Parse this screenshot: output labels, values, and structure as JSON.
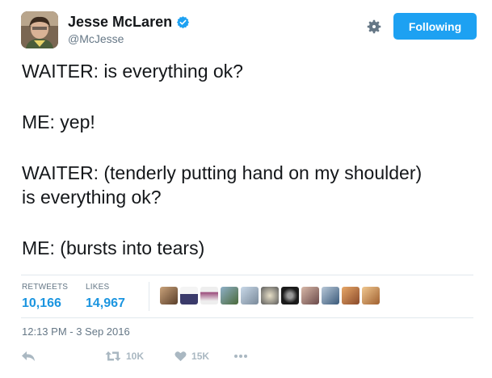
{
  "user": {
    "name": "Jesse McLaren",
    "handle": "@McJesse"
  },
  "header": {
    "follow_label": "Following"
  },
  "tweet": {
    "lines": [
      "WAITER: is everything ok?",
      "ME: yep!",
      "WAITER: (tenderly putting hand on my shoulder)",
      "is everything ok?",
      "ME: (bursts into tears)"
    ]
  },
  "stats": {
    "retweets_label": "RETWEETS",
    "retweets_value": "10,166",
    "likes_label": "LIKES",
    "likes_value": "14,967"
  },
  "timestamp": "12:13 PM - 3 Sep 2016",
  "actions": {
    "retweet_count": "10K",
    "like_count": "15K"
  },
  "colors": {
    "accent": "#1da1f2",
    "link": "#1b95e0",
    "muted": "#657786",
    "action_gray": "#aab8c2"
  },
  "icons": [
    "verified-badge-icon",
    "gear-icon",
    "reply-icon",
    "retweet-icon",
    "heart-icon",
    "more-icon"
  ]
}
